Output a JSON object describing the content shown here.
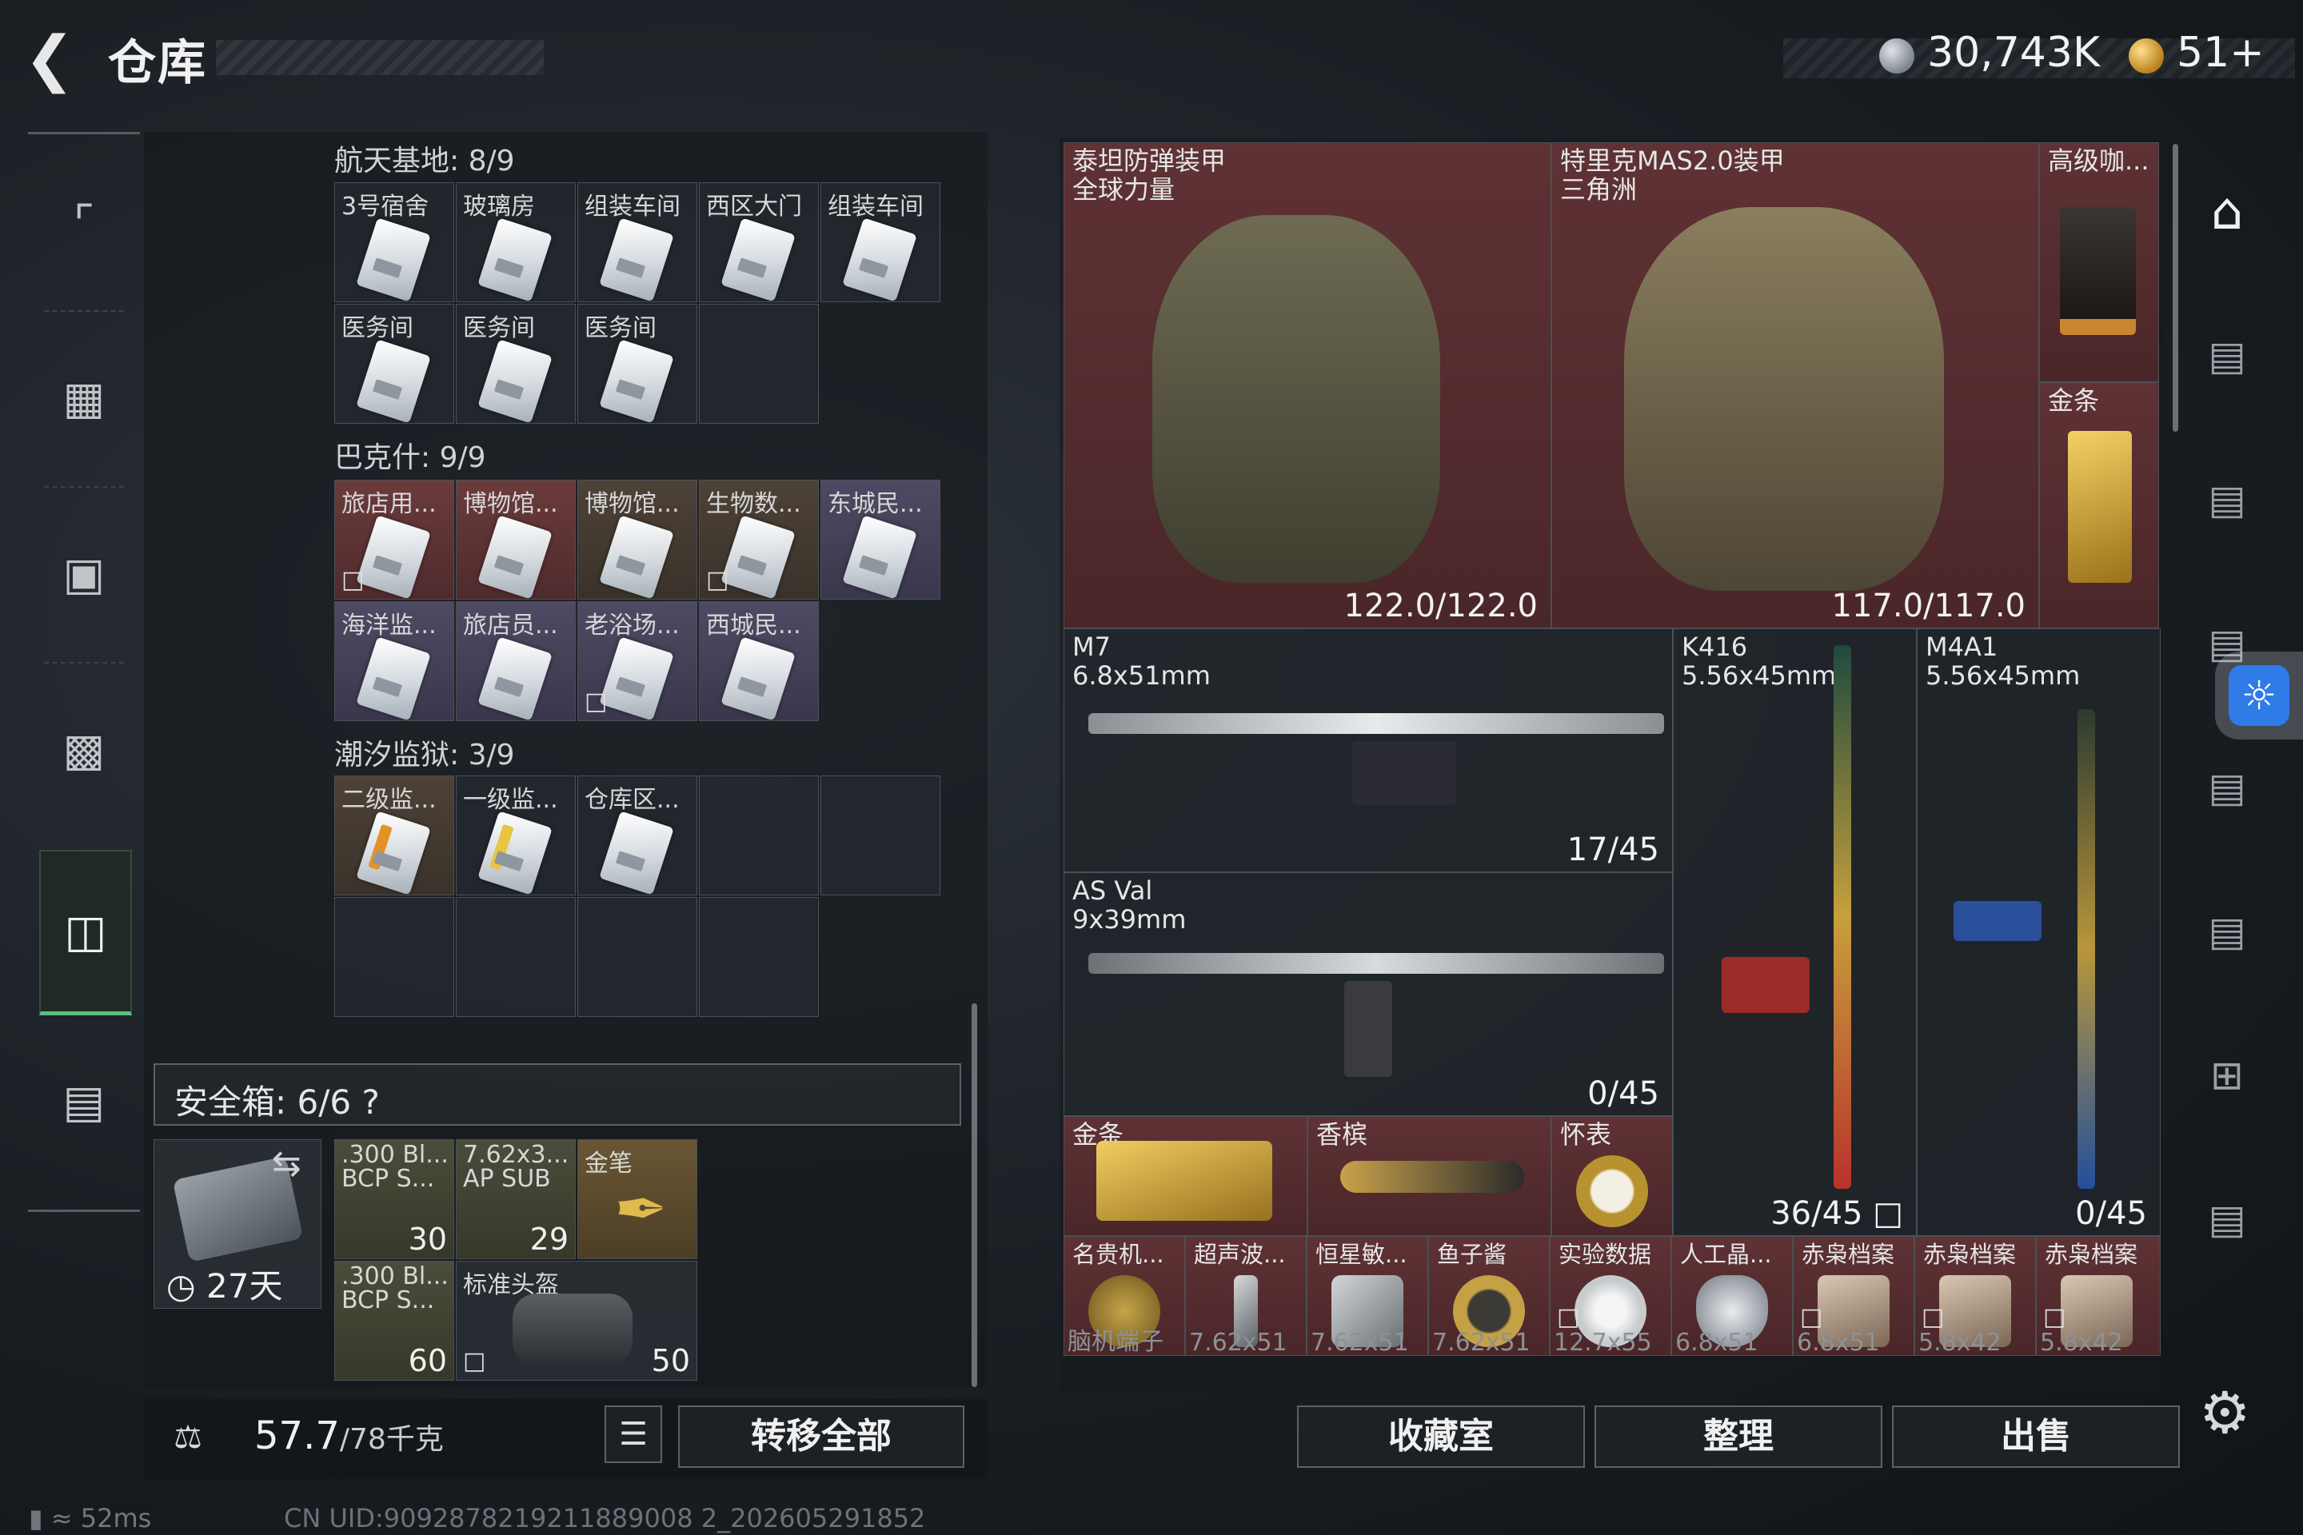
{
  "header": {
    "title": "仓库",
    "currency_silver": "30,743K",
    "currency_gold": "51+"
  },
  "nav": {
    "items": [
      "weapon-tab",
      "vest-tab",
      "backpack-tab",
      "bag-tab",
      "storage-tab",
      "briefcase-tab"
    ]
  },
  "sections": [
    {
      "label": "航天基地: 8/9",
      "items": [
        "3号宿舍",
        "玻璃房",
        "组装车间",
        "西区大门",
        "组装车间",
        "医务间",
        "医务间",
        "医务间"
      ]
    },
    {
      "label": "巴克什: 9/9",
      "items": [
        "旅店用...",
        "博物馆...",
        "博物馆...",
        "生物数...",
        "东城民...",
        "海洋监...",
        "旅店员...",
        "老浴场...",
        "西城民..."
      ]
    },
    {
      "label": "潮汐监狱: 3/9",
      "items": [
        "二级监...",
        "一级监...",
        "仓库区..."
      ]
    }
  ],
  "safebox": {
    "label": "安全箱: 6/6 ?",
    "days": "27天",
    "items": [
      {
        "name": ".300 Bl... BCP S...",
        "count": "30"
      },
      {
        "name": "7.62x3... AP SUB",
        "count": "29"
      },
      {
        "name": "金笔",
        "count": ""
      },
      {
        "name": ".300 Bl... BCP S...",
        "count": "60"
      },
      {
        "name": "标准头盔",
        "count": "50"
      }
    ]
  },
  "weight": {
    "current": "57.7",
    "max": "/78千克"
  },
  "buttons": {
    "transfer_all": "转移全部",
    "collection": "收藏室",
    "organize": "整理",
    "sell": "出售"
  },
  "stash": {
    "armor1": {
      "name": "泰坦防弹装甲",
      "sub": "全球力量",
      "durability": "122.0/122.0"
    },
    "armor2": {
      "name": "特里克MAS2.0装甲",
      "sub": "三角洲",
      "durability": "117.0/117.0"
    },
    "coffee": {
      "name": "高级咖..."
    },
    "goldbar_tall": {
      "name": "金条"
    },
    "m7": {
      "name": "M7",
      "caliber": "6.8x51mm",
      "ammo": "17/45"
    },
    "asval": {
      "name": "AS Val",
      "caliber": "9x39mm",
      "ammo": "0/45"
    },
    "k416": {
      "name": "K416",
      "caliber": "5.56x45mm",
      "ammo": "36/45"
    },
    "m4a1": {
      "name": "M4A1",
      "caliber": "5.56x45mm",
      "ammo": "0/45"
    },
    "small_items": [
      {
        "name": "金条"
      },
      {
        "name": "香槟"
      },
      {
        "name": "怀表"
      }
    ],
    "bottom_row": [
      "名贵机...",
      "超声波...",
      "恒星敏...",
      "鱼子酱",
      "实验数据",
      "人工晶...",
      "赤枭档案",
      "赤枭档案",
      "赤枭档案"
    ],
    "next_row": [
      "脑机端子",
      "7.62x51",
      "7.62x51",
      "7.62x51",
      "12.7x55",
      "6.8x51",
      "6.8x51",
      "5.8x42",
      "5.8x42"
    ]
  },
  "status": {
    "ping": "52ms",
    "uid": "CN UID:9092878219211889008 2_202605291852"
  },
  "colors": {
    "accent_green": "#5bbf84",
    "rarity_red": "#5f3234",
    "rarity_gold": "#6a5533",
    "rarity_purple": "#4e4a63",
    "accessibility_blue": "#2f7be8"
  }
}
